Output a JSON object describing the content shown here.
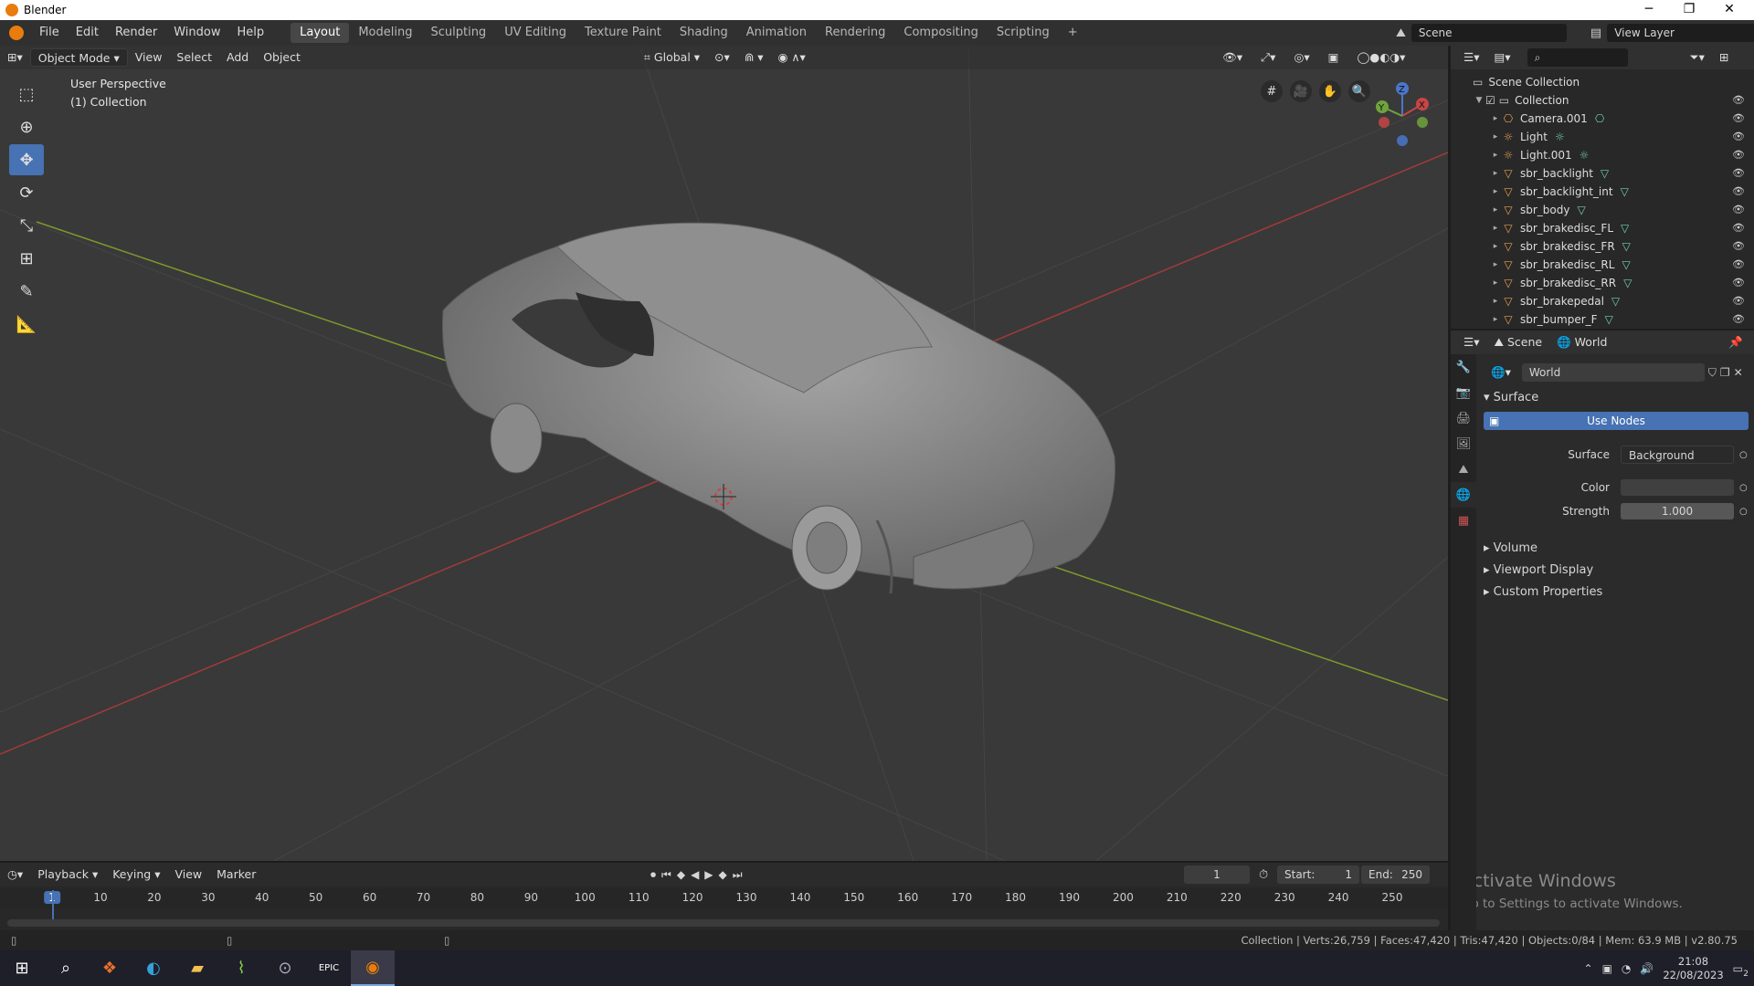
{
  "window": {
    "title": "Blender",
    "controls": {
      "minimize": "─",
      "restore": "❐",
      "close": "✕"
    }
  },
  "menu": {
    "items": [
      "File",
      "Edit",
      "Render",
      "Window",
      "Help"
    ],
    "workspaces": [
      "Layout",
      "Modeling",
      "Sculpting",
      "UV Editing",
      "Texture Paint",
      "Shading",
      "Animation",
      "Rendering",
      "Compositing",
      "Scripting"
    ],
    "active_workspace": "Layout",
    "add_tab": "+",
    "scene_value": "Scene",
    "view_layer_value": "View Layer"
  },
  "viewport_header": {
    "mode": "Object Mode",
    "menus": [
      "View",
      "Select",
      "Add",
      "Object"
    ],
    "orientation": "Global"
  },
  "viewport": {
    "perspective_label": "User Perspective",
    "collection_label": "(1) Collection",
    "gizmo_axes": {
      "z": "Z",
      "y": "Y",
      "x": "X"
    }
  },
  "outliner": {
    "root": "Scene Collection",
    "collection": "Collection",
    "items": [
      "Camera.001",
      "Light",
      "Light.001",
      "sbr_backlight",
      "sbr_backlight_int",
      "sbr_body",
      "sbr_brakedisc_FL",
      "sbr_brakedisc_FR",
      "sbr_brakedisc_RL",
      "sbr_brakedisc_RR",
      "sbr_brakepedal",
      "sbr_bumper_F"
    ]
  },
  "properties": {
    "tabs": {
      "scene": "Scene",
      "world": "World"
    },
    "world_name": "World",
    "surface_panel": "Surface",
    "use_nodes_label": "Use Nodes",
    "surface_label": "Surface",
    "surface_value": "Background",
    "color_label": "Color",
    "strength_label": "Strength",
    "strength_value": "1.000",
    "collapsed_panels": [
      "Volume",
      "Viewport Display",
      "Custom Properties"
    ]
  },
  "timeline": {
    "menus": [
      "Playback",
      "Keying",
      "View",
      "Marker"
    ],
    "current_frame": "1",
    "start_label": "Start:",
    "start_value": "1",
    "end_label": "End:",
    "end_value": "250",
    "ruler_ticks": [
      "1",
      "10",
      "20",
      "30",
      "40",
      "50",
      "60",
      "70",
      "80",
      "90",
      "100",
      "110",
      "120",
      "130",
      "140",
      "150",
      "160",
      "170",
      "180",
      "190",
      "200",
      "210",
      "220",
      "230",
      "240",
      "250"
    ]
  },
  "watermark": {
    "title": "Activate Windows",
    "subtitle": "Go to Settings to activate Windows."
  },
  "statusbar": {
    "stats": "Collection | Verts:26,759 | Faces:47,420 | Tris:47,420 | Objects:0/84 | Mem: 63.9 MB | v2.80.75"
  },
  "taskbar": {
    "time": "21:08",
    "date": "22/08/2023",
    "notifications": "2"
  },
  "colors": {
    "accent": "#4772b3",
    "axis_x": "#a33a3a",
    "axis_y": "#7d9a2b",
    "orange": "#e87d0d"
  }
}
